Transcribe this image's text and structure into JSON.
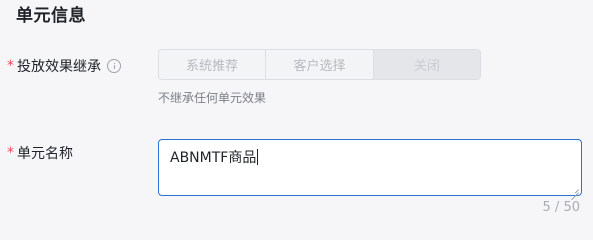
{
  "section": {
    "title": "单元信息"
  },
  "effect_inherit": {
    "required_mark": "*",
    "label": "投放效果继承",
    "info_icon": "info-circle-icon",
    "options": [
      {
        "label": "系统推荐",
        "selected": false,
        "disabled": true
      },
      {
        "label": "客户选择",
        "selected": false,
        "disabled": true
      },
      {
        "label": "关闭",
        "selected": true,
        "disabled": true
      }
    ],
    "help_text": "不继承任何单元效果"
  },
  "unit_name": {
    "required_mark": "*",
    "label": "单元名称",
    "value": "ABNMTF商品",
    "counter": "5 / 50"
  },
  "colors": {
    "required": "#e34d59",
    "focus_border": "#2c6fd6",
    "background": "#f6f6f8"
  }
}
